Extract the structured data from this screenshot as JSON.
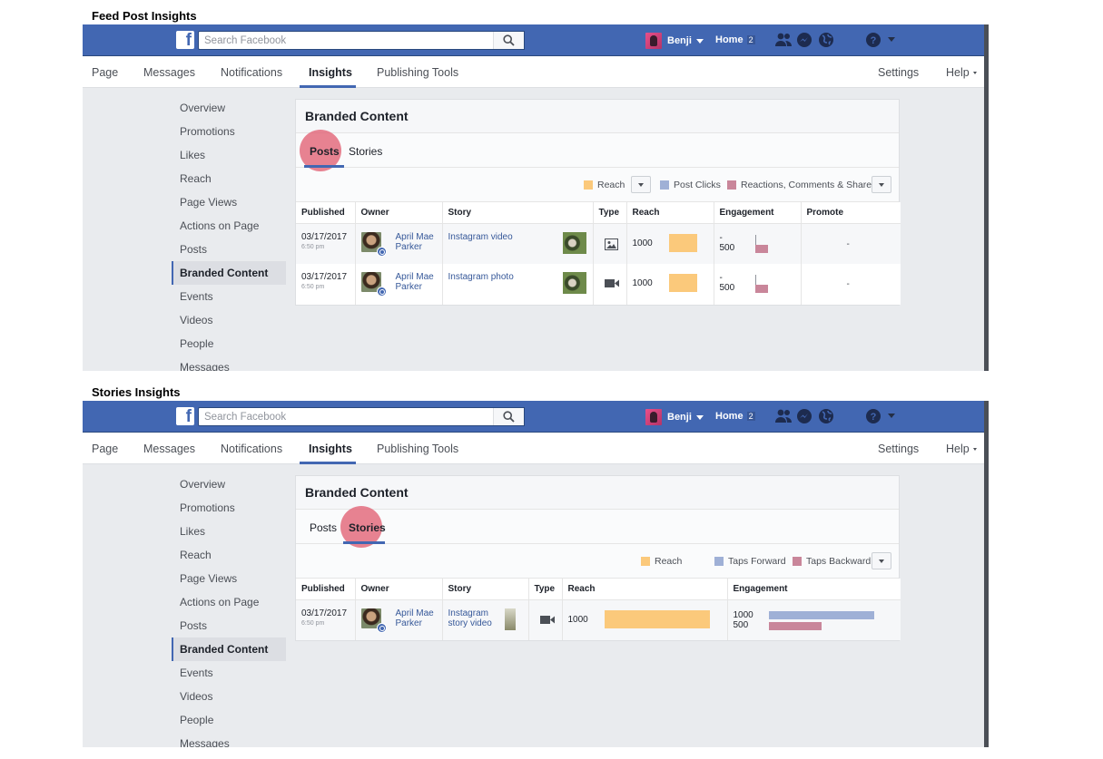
{
  "panels": [
    {
      "title": "Feed Post Insights",
      "search_placeholder": "Search Facebook",
      "profile_name": "Benji",
      "home_label": "Home",
      "home_count": "2",
      "tabs": [
        "Page",
        "Messages",
        "Notifications",
        "Insights",
        "Publishing Tools",
        "Settings",
        "Help"
      ],
      "active_tab": "Insights",
      "left_nav": [
        "Overview",
        "Promotions",
        "Likes",
        "Reach",
        "Page Views",
        "Actions on Page",
        "Posts",
        "Branded Content",
        "Events",
        "Videos",
        "People",
        "Messages"
      ],
      "active_nav": "Branded Content",
      "card_title": "Branded Content",
      "subtabs": [
        "Posts",
        "Stories"
      ],
      "active_subtab": "Posts",
      "legend": [
        {
          "label": "Reach",
          "color": "#fbc97b"
        },
        {
          "label": "Post Clicks",
          "color": "#9fb0d6"
        },
        {
          "label": "Reactions, Comments & Shares",
          "color": "#c9869a"
        }
      ],
      "columns": [
        "Published",
        "Owner",
        "Story",
        "Type",
        "Reach",
        "Engagement",
        "Promote"
      ],
      "rows": [
        {
          "date": "03/17/2017",
          "time": "6:50 pm",
          "owner_first": "April Mae",
          "owner_last": "Parker",
          "story": "Instagram video",
          "type_icon": "photo-icon",
          "reach": "1000",
          "reach_fraction": 1.0,
          "eng_top": "-",
          "eng_bottom": "500",
          "promote": "-"
        },
        {
          "date": "03/17/2017",
          "time": "6:50 pm",
          "owner_first": "April Mae",
          "owner_last": "Parker",
          "story": "Instagram photo",
          "type_icon": "video-icon",
          "reach": "1000",
          "reach_fraction": 1.0,
          "eng_top": "-",
          "eng_bottom": "500",
          "promote": "-"
        }
      ]
    },
    {
      "title": "Stories Insights",
      "search_placeholder": "Search Facebook",
      "profile_name": "Benji",
      "home_label": "Home",
      "home_count": "2",
      "tabs": [
        "Page",
        "Messages",
        "Notifications",
        "Insights",
        "Publishing Tools",
        "Settings",
        "Help"
      ],
      "active_tab": "Insights",
      "left_nav": [
        "Overview",
        "Promotions",
        "Likes",
        "Reach",
        "Page Views",
        "Actions on Page",
        "Posts",
        "Branded Content",
        "Events",
        "Videos",
        "People",
        "Messages"
      ],
      "active_nav": "Branded Content",
      "card_title": "Branded Content",
      "subtabs": [
        "Posts",
        "Stories"
      ],
      "active_subtab": "Stories",
      "legend": [
        {
          "label": "Reach",
          "color": "#fbc97b"
        },
        {
          "label": "Taps Forward",
          "color": "#9fb0d6"
        },
        {
          "label": "Taps Backward",
          "color": "#c9869a"
        }
      ],
      "columns": [
        "Published",
        "Owner",
        "Story",
        "Type",
        "Reach",
        "Engagement"
      ],
      "rows": [
        {
          "date": "03/17/2017",
          "time": "6:50 pm",
          "owner_first": "April Mae",
          "owner_last": "Parker",
          "story_line1": "Instagram",
          "story_line2": "story video",
          "type_icon": "video-icon",
          "reach": "1000",
          "reach_fraction": 1.0,
          "eng_top": "1000",
          "eng_bottom": "500",
          "eng_top_fraction": 1.0,
          "eng_bottom_fraction": 0.5
        }
      ]
    }
  ],
  "colors": {
    "bluebar": "#4267b2",
    "link": "#365899",
    "highlight": "#e05a6e"
  }
}
